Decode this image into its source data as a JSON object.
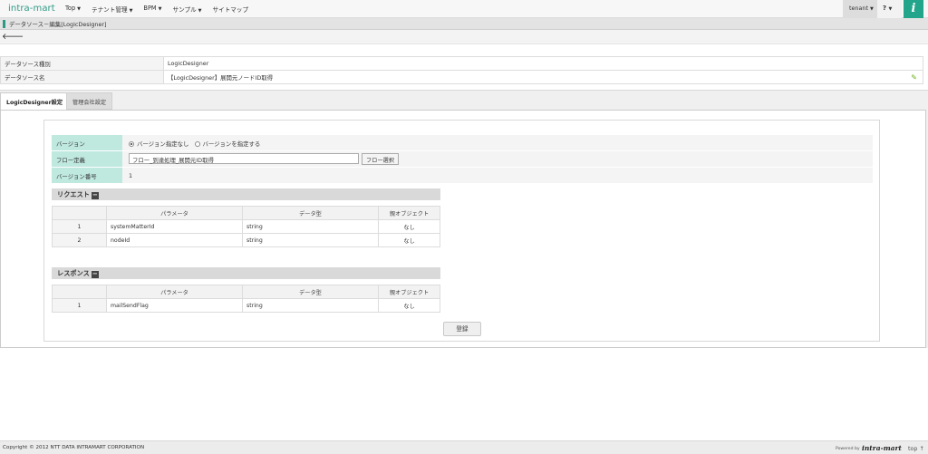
{
  "header": {
    "logo": "intra-mart",
    "nav": [
      {
        "label": "Top"
      },
      {
        "label": "テナント管理"
      },
      {
        "label": "BPM"
      },
      {
        "label": "サンプル"
      },
      {
        "label": "サイトマップ"
      }
    ],
    "tenant": "tenant",
    "help": "?",
    "info_icon": "i"
  },
  "titlebar": {
    "title": "データソース－編集[LogicDesigner]"
  },
  "info": {
    "type_label": "データソース種別",
    "type_value": "LogicDesigner",
    "name_label": "データソース名",
    "name_value": "【LogicDesigner】展開元ノードID取得"
  },
  "tabs": [
    {
      "label": "LogicDesigner設定",
      "active": true
    },
    {
      "label": "管理会社設定",
      "active": false
    }
  ],
  "form": {
    "version_label": "バージョン",
    "radio_none": "バージョン指定なし",
    "radio_specify": "バージョンを指定する",
    "flow_label": "フロー定義",
    "flow_value": "フロー_到達処理_展開元ID取得",
    "flow_button": "フロー選択",
    "vernum_label": "バージョン番号",
    "vernum_value": "1"
  },
  "request": {
    "title": "リクエスト",
    "toggle": "−",
    "columns": [
      "",
      "パラメータ",
      "データ型",
      "親オブジェクト"
    ],
    "rows": [
      {
        "no": "1",
        "param": "systemMatterId",
        "type": "string",
        "parent": "なし"
      },
      {
        "no": "2",
        "param": "nodeId",
        "type": "string",
        "parent": "なし"
      }
    ]
  },
  "response": {
    "title": "レスポンス",
    "toggle": "−",
    "columns": [
      "",
      "パラメータ",
      "データ型",
      "親オブジェクト"
    ],
    "rows": [
      {
        "no": "1",
        "param": "mailSendFlag",
        "type": "string",
        "parent": "なし"
      }
    ]
  },
  "register_button": "登録",
  "footer": {
    "copyright": "Copyright © 2012 NTT DATA INTRAMART CORPORATION",
    "powered": "Powered by",
    "brand": "intra-mart",
    "top_link": "top ↑"
  },
  "colors": {
    "accent": "#22a58a",
    "label_bg": "#bfe8df"
  }
}
